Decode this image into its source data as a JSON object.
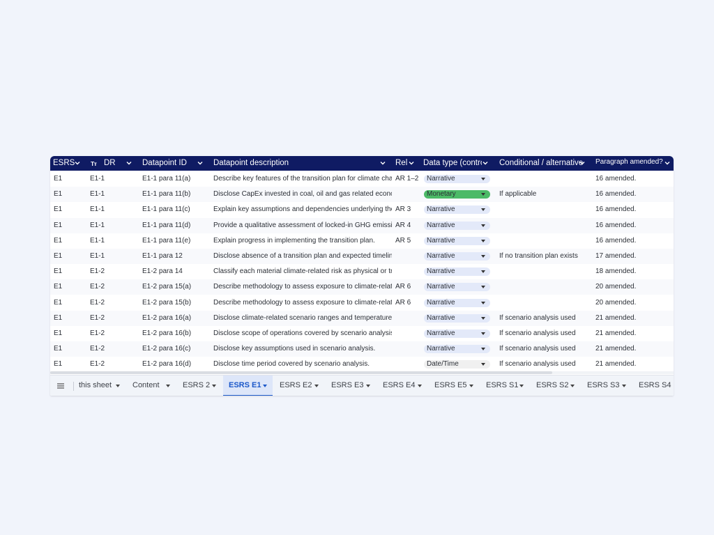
{
  "colors": {
    "header_bg": "#0f1b63",
    "narrative_chip": "#e3e9f9",
    "monetary_chip": "#4cba67",
    "datetime_chip": "#f0f0f0",
    "active_tab": "#1a57c9"
  },
  "header": {
    "esrs": "ESRS",
    "dr_icon": "Tт",
    "dr": "DR",
    "datapoint_id": "Datapoint ID",
    "description": "Datapoint description",
    "rel": "Rel",
    "data_type": "Data type (control",
    "conditional": "Conditional / alternative",
    "amended": "Paragraph amended?"
  },
  "rows": [
    {
      "esrs": "E1",
      "dr": "E1-1",
      "id": "E1-1 para 11(a)",
      "desc": "Describe key features of the transition plan for climate chang",
      "rel": "AR 1–2",
      "type": "Narrative",
      "cond": "",
      "amend": "16 amended."
    },
    {
      "esrs": "E1",
      "dr": "E1-1",
      "id": "E1-1 para 11(b)",
      "desc": "Disclose CapEx invested in coal, oil and gas related economic",
      "rel": "",
      "type": "Monetary",
      "cond": "If applicable",
      "amend": "16 amended."
    },
    {
      "esrs": "E1",
      "dr": "E1-1",
      "id": "E1-1 para 11(c)",
      "desc": "Explain key assumptions and dependencies underlying the tr",
      "rel": "AR 3",
      "type": "Narrative",
      "cond": "",
      "amend": "16 amended."
    },
    {
      "esrs": "E1",
      "dr": "E1-1",
      "id": "E1-1 para 11(d)",
      "desc": "Provide a qualitative assessment of locked-in GHG emissions",
      "rel": "AR 4",
      "type": "Narrative",
      "cond": "",
      "amend": "16 amended."
    },
    {
      "esrs": "E1",
      "dr": "E1-1",
      "id": "E1-1 para 11(e)",
      "desc": "Explain progress in implementing the transition plan.",
      "rel": "AR 5",
      "type": "Narrative",
      "cond": "",
      "amend": "16 amended."
    },
    {
      "esrs": "E1",
      "dr": "E1-1",
      "id": "E1-1 para 12",
      "desc": "Disclose absence of a transition plan and expected timeline fo",
      "rel": "",
      "type": "Narrative",
      "cond": "If no transition plan exists",
      "amend": "17 amended."
    },
    {
      "esrs": "E1",
      "dr": "E1-2",
      "id": "E1-2 para 14",
      "desc": "Classify each material climate-related risk as physical or trans",
      "rel": "",
      "type": "Narrative",
      "cond": "",
      "amend": "18 amended."
    },
    {
      "esrs": "E1",
      "dr": "E1-2",
      "id": "E1-2 para 15(a)",
      "desc": "Describe methodology to assess exposure to climate-related",
      "rel": "AR 6",
      "type": "Narrative",
      "cond": "",
      "amend": "20 amended."
    },
    {
      "esrs": "E1",
      "dr": "E1-2",
      "id": "E1-2 para 15(b)",
      "desc": "Describe methodology to assess exposure to climate-related",
      "rel": "AR 6",
      "type": "Narrative",
      "cond": "",
      "amend": "20 amended."
    },
    {
      "esrs": "E1",
      "dr": "E1-2",
      "id": "E1-2 para 16(a)",
      "desc": "Disclose climate-related scenario ranges and temperature pa",
      "rel": "",
      "type": "Narrative",
      "cond": "If scenario analysis used",
      "amend": "21 amended."
    },
    {
      "esrs": "E1",
      "dr": "E1-2",
      "id": "E1-2 para 16(b)",
      "desc": "Disclose scope of operations covered by scenario analysis.",
      "rel": "",
      "type": "Narrative",
      "cond": "If scenario analysis used",
      "amend": "21 amended."
    },
    {
      "esrs": "E1",
      "dr": "E1-2",
      "id": "E1-2 para 16(c)",
      "desc": "Disclose key assumptions used in scenario analysis.",
      "rel": "",
      "type": "Narrative",
      "cond": "If scenario analysis used",
      "amend": "21 amended."
    },
    {
      "esrs": "E1",
      "dr": "E1-2",
      "id": "E1-2 para 16(d)",
      "desc": "Disclose time period covered by scenario analysis.",
      "rel": "",
      "type": "Date/Time",
      "cond": "If scenario analysis used",
      "amend": "21 amended."
    }
  ],
  "tabs": [
    "this sheet",
    "Content",
    "ESRS 2",
    "ESRS E1",
    "ESRS E2",
    "ESRS E3",
    "ESRS E4",
    "ESRS E5",
    "ESRS S1",
    "ESRS S2",
    "ESRS S3",
    "ESRS S4"
  ],
  "active_tab": "ESRS E1"
}
